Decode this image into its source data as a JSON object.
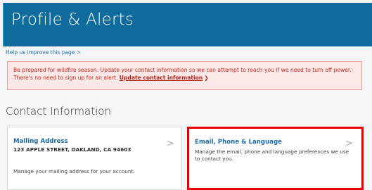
{
  "header": {
    "title": "Profile & Alerts"
  },
  "improve_link": "Help us improve this page >",
  "alert": {
    "text": "Be prepared for wildfire season. Update your contact information so we can attempt to reach you if we need to turn off power. There's no need to sign up for an alert.",
    "link_label": "Update contact information",
    "link_arrow": "❯"
  },
  "section": {
    "title": "Contact Information"
  },
  "cards": [
    {
      "title": "Mailing Address",
      "address": "123 APPLE STREET, OAKLAND, CA 94603",
      "description": "Manage your mailing address for your account.",
      "chevron": ">"
    },
    {
      "title": "Email, Phone & Language",
      "description": "Manage the email, phone and language preferences we use to contact you.",
      "chevron": ">"
    }
  ],
  "colors": {
    "header_bg": "#0f6c9d",
    "link": "#1f6fb3",
    "alert_text": "#c4261c",
    "alert_bg": "#fce9e7",
    "highlight": "#ee0000"
  }
}
